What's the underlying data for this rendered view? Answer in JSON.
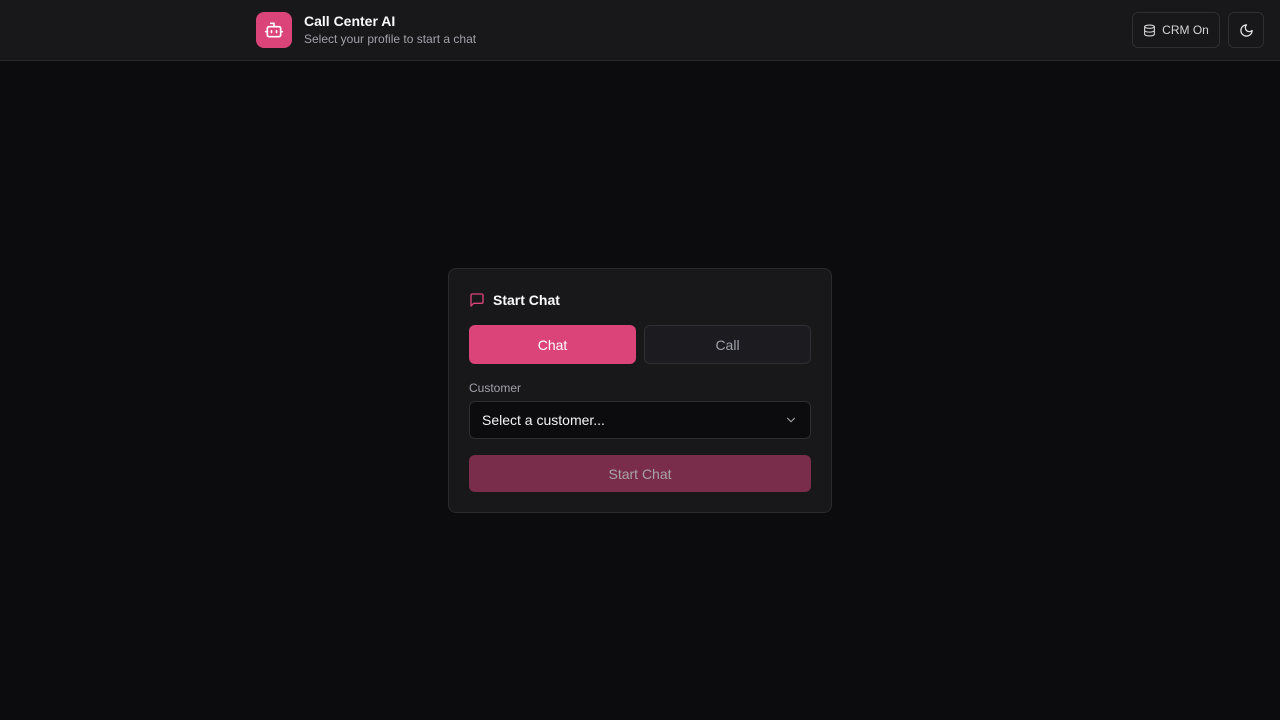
{
  "header": {
    "title": "Call Center AI",
    "subtitle": "Select your profile to start a chat",
    "logo_icon": "bot-icon",
    "crm_label": "CRM On",
    "crm_icon": "database-icon",
    "theme_icon": "moon-icon"
  },
  "card": {
    "title": "Start Chat",
    "title_icon": "message-square-icon",
    "modes": [
      "Chat",
      "Call"
    ],
    "selected_mode": "Chat",
    "customer_label": "Customer",
    "customer_placeholder": "Select a customer...",
    "start_label": "Start Chat"
  },
  "colors": {
    "accent": "#db4479",
    "background": "#0c0c0e",
    "surface": "#18181b"
  }
}
